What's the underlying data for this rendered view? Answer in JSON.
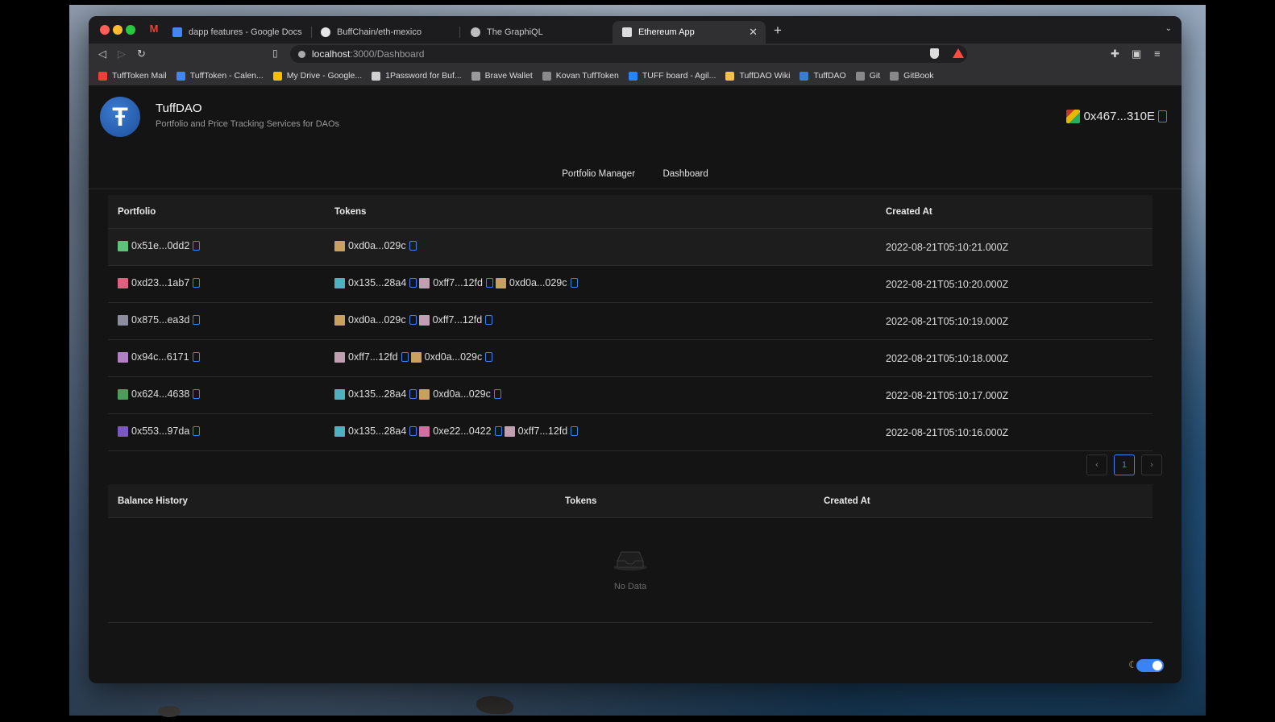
{
  "browser": {
    "tabs": [
      {
        "label": "dapp features - Google Docs",
        "color": "#4285f4"
      },
      {
        "label": "BuffChain/eth-mexico",
        "color": "#e6e6e6"
      },
      {
        "label": "The GraphiQL",
        "color": "#bdbdbd"
      },
      {
        "label": "Ethereum App",
        "color": "#dddddd",
        "active": true
      }
    ],
    "url_host": "localhost",
    "url_path": ":3000/Dashboard",
    "bookmarks": [
      {
        "label": "TuffToken Mail",
        "color": "#ea4335"
      },
      {
        "label": "TuffToken - Calen...",
        "color": "#4285f4"
      },
      {
        "label": "My Drive - Google...",
        "color": "#fbbc05"
      },
      {
        "label": "1Password for Buf...",
        "color": "#d0d0d0"
      },
      {
        "label": "Brave Wallet",
        "color": "#9a9a9a"
      },
      {
        "label": "Kovan TuffToken",
        "color": "#8a8a8a"
      },
      {
        "label": "TUFF board - Agil...",
        "color": "#2684ff"
      },
      {
        "label": "TuffDAO Wiki",
        "color": "#f2c14e"
      },
      {
        "label": "TuffDAO",
        "color": "#3b7bd0"
      },
      {
        "label": "Git",
        "color": "#888888"
      },
      {
        "label": "GitBook",
        "color": "#888888"
      }
    ]
  },
  "app": {
    "logo_letter": "Ŧ",
    "title": "TuffDAO",
    "subtitle": "Portfolio and Price Tracking Services for DAOs",
    "wallet": "0x467...310E",
    "nav": [
      "Portfolio Manager",
      "Dashboard"
    ]
  },
  "portfolio_table": {
    "headers": [
      "Portfolio",
      "Tokens",
      "Created At"
    ],
    "rows": [
      {
        "portfolio": "0x51e...0dd2",
        "pcolor": "#5ec27a",
        "tokens": [
          {
            "t": "0xd0a...029c",
            "c": "#c8a060"
          }
        ],
        "created": "2022-08-21T05:10:21.000Z"
      },
      {
        "portfolio": "0xd23...1ab7",
        "pcolor": "#e06080",
        "tokens": [
          {
            "t": "0x135...28a4",
            "c": "#4fb0c0"
          },
          {
            "t": "0xff7...12fd",
            "c": "#c0a0b0"
          },
          {
            "t": "0xd0a...029c",
            "c": "#c8a060"
          }
        ],
        "created": "2022-08-21T05:10:20.000Z"
      },
      {
        "portfolio": "0x875...ea3d",
        "pcolor": "#8c8c9c",
        "tokens": [
          {
            "t": "0xd0a...029c",
            "c": "#c8a060"
          },
          {
            "t": "0xff7...12fd",
            "c": "#c0a0b0"
          }
        ],
        "created": "2022-08-21T05:10:19.000Z"
      },
      {
        "portfolio": "0x94c...6171",
        "pcolor": "#b080c0",
        "tokens": [
          {
            "t": "0xff7...12fd",
            "c": "#c0a0b0"
          },
          {
            "t": "0xd0a...029c",
            "c": "#c8a060"
          }
        ],
        "created": "2022-08-21T05:10:18.000Z"
      },
      {
        "portfolio": "0x624...4638",
        "pcolor": "#4c9c5c",
        "tokens": [
          {
            "t": "0x135...28a4",
            "c": "#4fb0c0"
          },
          {
            "t": "0xd0a...029c",
            "c": "#c8a060"
          }
        ],
        "created": "2022-08-21T05:10:17.000Z"
      },
      {
        "portfolio": "0x553...97da",
        "pcolor": "#7a58c0",
        "tokens": [
          {
            "t": "0x135...28a4",
            "c": "#4fb0c0"
          },
          {
            "t": "0xe22...0422",
            "c": "#d070a0"
          },
          {
            "t": "0xff7...12fd",
            "c": "#c0a0b0"
          }
        ],
        "created": "2022-08-21T05:10:16.000Z"
      }
    ]
  },
  "pagination": {
    "prev": "‹",
    "current": "1",
    "next": "›"
  },
  "balance_table": {
    "headers": [
      "Balance History",
      "Tokens",
      "Created At"
    ],
    "empty": "No Data"
  },
  "colors": {
    "accent": "#3b82f6",
    "page_bg": "#141414"
  }
}
